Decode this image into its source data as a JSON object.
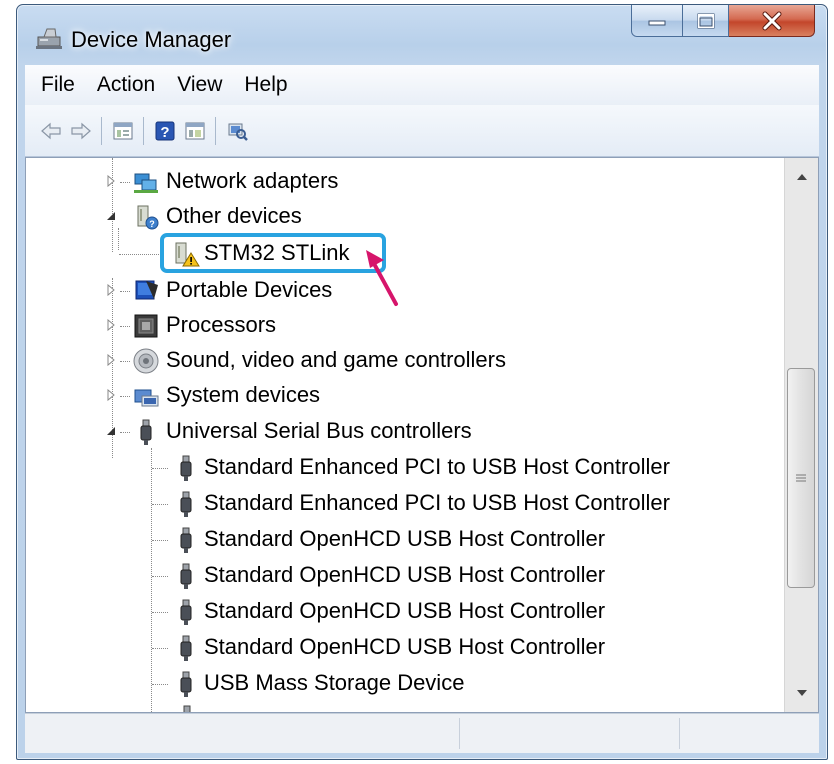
{
  "window": {
    "title": "Device Manager",
    "buttons": {
      "minimize": "minimize",
      "maximize": "maximize",
      "close": "close"
    }
  },
  "menu": [
    "File",
    "Action",
    "View",
    "Help"
  ],
  "toolbar": {
    "icons": [
      "back-arrow-icon",
      "forward-arrow-icon",
      "properties-icon",
      "help-icon",
      "show-hide-console-tree-icon",
      "scan-hardware-icon"
    ]
  },
  "tree": {
    "categories": [
      {
        "label": "Network adapters",
        "icon": "network-adapter-icon",
        "expanded": false
      },
      {
        "label": "Other devices",
        "icon": "other-devices-icon",
        "expanded": true,
        "children": [
          {
            "label": "STM32 STLink",
            "icon": "unknown-device-warning-icon",
            "highlighted": true
          }
        ]
      },
      {
        "label": "Portable Devices",
        "icon": "portable-device-icon",
        "expanded": false
      },
      {
        "label": "Processors",
        "icon": "processor-icon",
        "expanded": false
      },
      {
        "label": "Sound, video and game controllers",
        "icon": "speaker-icon",
        "expanded": false
      },
      {
        "label": "System devices",
        "icon": "system-devices-icon",
        "expanded": false
      },
      {
        "label": "Universal Serial Bus controllers",
        "icon": "usb-icon",
        "expanded": true,
        "children": [
          {
            "label": "Standard Enhanced PCI to USB Host Controller",
            "icon": "usb-icon"
          },
          {
            "label": "Standard Enhanced PCI to USB Host Controller",
            "icon": "usb-icon"
          },
          {
            "label": "Standard OpenHCD USB Host Controller",
            "icon": "usb-icon"
          },
          {
            "label": "Standard OpenHCD USB Host Controller",
            "icon": "usb-icon"
          },
          {
            "label": "Standard OpenHCD USB Host Controller",
            "icon": "usb-icon"
          },
          {
            "label": "Standard OpenHCD USB Host Controller",
            "icon": "usb-icon"
          },
          {
            "label": "USB Mass Storage Device",
            "icon": "usb-icon"
          }
        ]
      }
    ]
  },
  "annotation": {
    "highlight_color": "#29a3e0",
    "arrow_color": "#d6156b"
  },
  "colors": {
    "title_bar": "#bcd2ea",
    "close_button": "#c3462b"
  }
}
